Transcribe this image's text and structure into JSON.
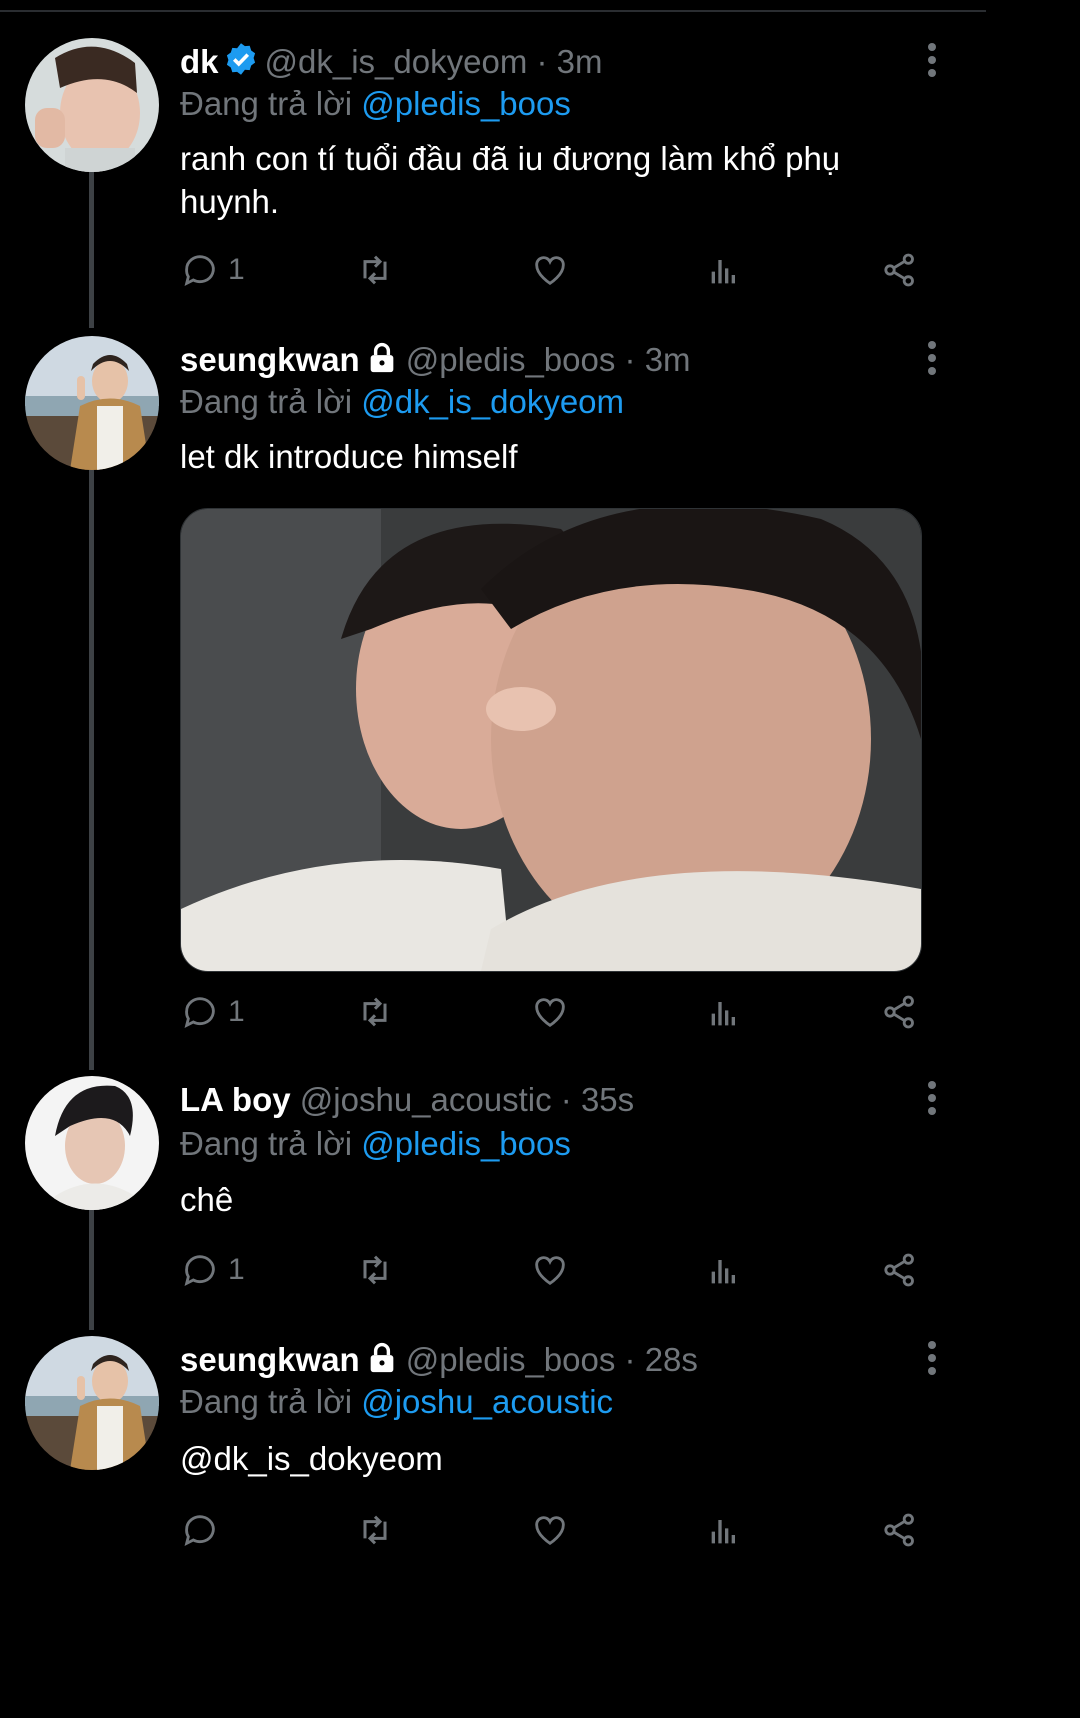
{
  "tweets": [
    {
      "name": "dk",
      "verified": true,
      "handle": "@dk_is_dokyeom",
      "time": "3m",
      "replying_prefix": "Đang trả lời",
      "replying_to": "@pledis_boos",
      "text": "ranh con tí tuổi đầu đã iu đương làm khổ phụ huynh.",
      "reply_count": "1"
    },
    {
      "name": "seungkwan",
      "locked": true,
      "handle": "@pledis_boos",
      "time": "3m",
      "replying_prefix": "Đang trả lời",
      "replying_to": "@dk_is_dokyeom",
      "text": "let dk introduce himself",
      "reply_count": "1"
    },
    {
      "name": "LA boy",
      "handle": "@joshu_acoustic",
      "time": "35s",
      "replying_prefix": "Đang trả lời",
      "replying_to": "@pledis_boos",
      "text": "chê",
      "reply_count": "1"
    },
    {
      "name": "seungkwan",
      "locked": true,
      "handle": "@pledis_boos",
      "time": "28s",
      "replying_prefix": "Đang trả lời",
      "replying_to": "@joshu_acoustic",
      "text": "@dk_is_dokyeom",
      "reply_count": ""
    }
  ],
  "separator": "·",
  "colors": {
    "background": "#000000",
    "text": "#e7e9ea",
    "muted": "#71767b",
    "accent": "#1d9bf0"
  },
  "icons": [
    "verified-badge-icon",
    "lock-icon",
    "more-icon",
    "reply-icon",
    "retweet-icon",
    "like-icon",
    "views-icon",
    "share-icon"
  ]
}
